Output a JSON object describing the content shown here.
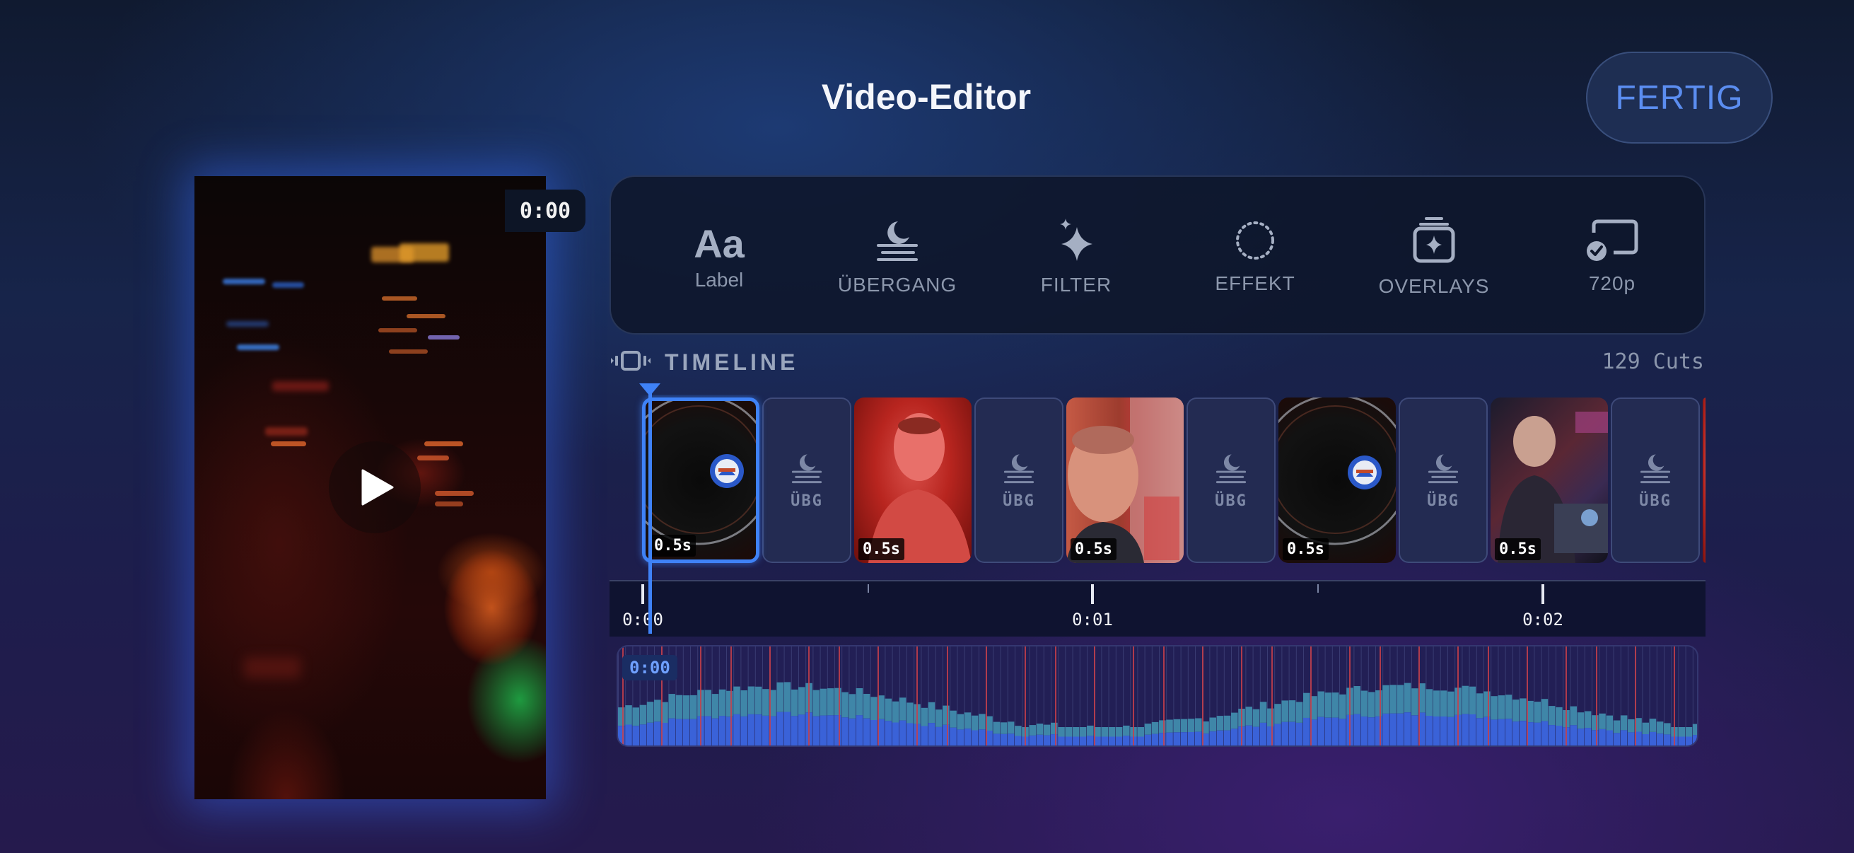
{
  "header": {
    "title": "Video-Editor",
    "done_label": "FERTIG"
  },
  "preview": {
    "current_time": "0:00"
  },
  "toolbar": {
    "items": [
      {
        "label": "Label",
        "icon": "text-aa-icon"
      },
      {
        "label": "ÜBERGANG",
        "icon": "transition-moon-icon"
      },
      {
        "label": "FILTER",
        "icon": "sparkles-icon"
      },
      {
        "label": "EFFEKT",
        "icon": "dotted-circle-icon"
      },
      {
        "label": "OVERLAYS",
        "icon": "overlay-stack-icon"
      },
      {
        "label": "720p",
        "icon": "cast-resolution-icon"
      }
    ]
  },
  "timeline": {
    "title": "TIMELINE",
    "cuts": "129 Cuts",
    "clips": [
      {
        "duration": "0.5s",
        "thumb": "disc",
        "selected": true
      },
      {
        "duration": "0.5s",
        "thumb": "red-man"
      },
      {
        "duration": "0.5s",
        "thumb": "selfie"
      },
      {
        "duration": "0.5s",
        "thumb": "disc"
      },
      {
        "duration": "0.5s",
        "thumb": "dj"
      }
    ],
    "transition_label": "ÜBG",
    "ruler_labels": [
      "0:00",
      "0:01",
      "0:02"
    ]
  },
  "waveform": {
    "time": "0:00"
  },
  "colors": {
    "accent": "#3f82f7",
    "done_text": "#5b8df0",
    "cut_marker": "#c8404a"
  }
}
